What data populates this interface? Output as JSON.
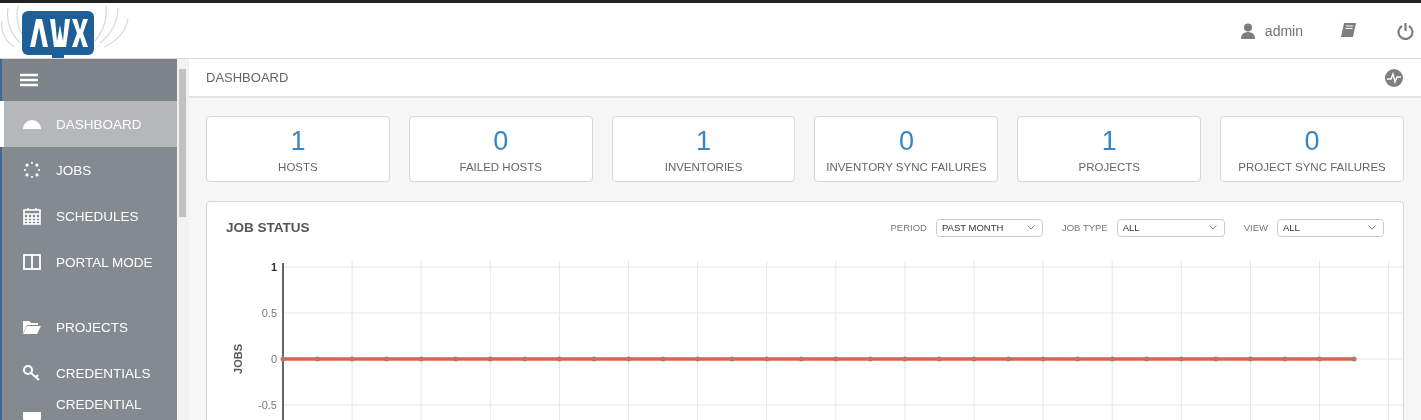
{
  "header": {
    "user": "admin"
  },
  "sidebar": {
    "items": [
      {
        "label": "DASHBOARD",
        "selected": true
      },
      {
        "label": "JOBS",
        "selected": false
      },
      {
        "label": "SCHEDULES",
        "selected": false
      },
      {
        "label": "PORTAL MODE",
        "selected": false
      },
      {
        "label": "PROJECTS",
        "selected": false
      },
      {
        "label": "CREDENTIALS",
        "selected": false
      },
      {
        "label": "CREDENTIAL",
        "selected": false
      }
    ]
  },
  "breadcrumb": "DASHBOARD",
  "counts": [
    {
      "value": "1",
      "label": "HOSTS"
    },
    {
      "value": "0",
      "label": "FAILED HOSTS"
    },
    {
      "value": "1",
      "label": "INVENTORIES"
    },
    {
      "value": "0",
      "label": "INVENTORY SYNC FAILURES"
    },
    {
      "value": "1",
      "label": "PROJECTS"
    },
    {
      "value": "0",
      "label": "PROJECT SYNC FAILURES"
    }
  ],
  "job_status": {
    "title": "JOB STATUS",
    "filters": [
      {
        "label": "PERIOD",
        "value": "PAST MONTH"
      },
      {
        "label": "JOB TYPE",
        "value": "ALL"
      },
      {
        "label": "VIEW",
        "value": "ALL"
      }
    ],
    "chart_data": {
      "type": "line",
      "grid": true,
      "ylabel": "JOBS",
      "yticks": [
        -0.5,
        0,
        0.5,
        1
      ],
      "ylim": [
        -0.5,
        1
      ],
      "series": [
        {
          "color": "#d8634e",
          "values": [
            0,
            0,
            0,
            0,
            0,
            0,
            0,
            0,
            0,
            0,
            0,
            0,
            0,
            0,
            0,
            0,
            0,
            0,
            0,
            0,
            0,
            0,
            0,
            0,
            0,
            0,
            0,
            0,
            0,
            0,
            0,
            0
          ]
        }
      ]
    }
  }
}
